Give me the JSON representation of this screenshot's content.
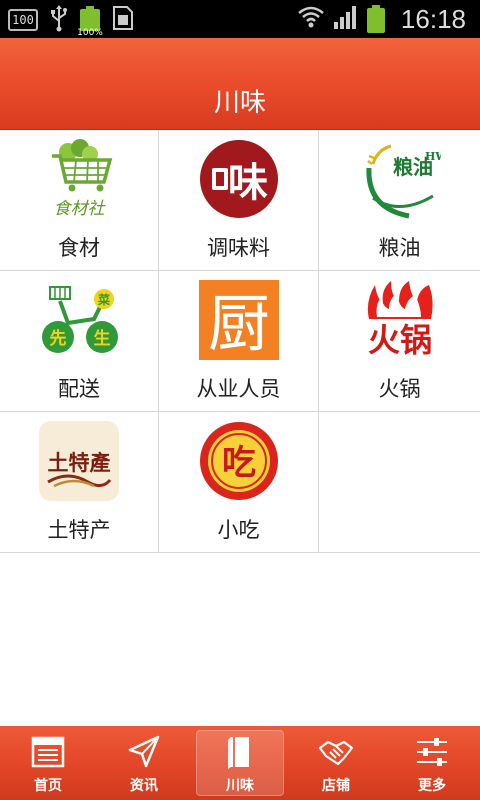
{
  "status_bar": {
    "box_label": "100",
    "battery_small_pct": "100%",
    "time": "16:18"
  },
  "header": {
    "title": "川味"
  },
  "grid": {
    "items": [
      {
        "label": "食材",
        "icon": "shopping-cart-vegetables-icon",
        "logo_text": "食材社"
      },
      {
        "label": "调味料",
        "icon": "spice-logo-icon",
        "logo_text": "味"
      },
      {
        "label": "粮油",
        "icon": "grain-oil-logo-icon",
        "logo_text": "粮油",
        "logo_sub": "HWP"
      },
      {
        "label": "配送",
        "icon": "delivery-bike-icon",
        "logo_text": "先生",
        "logo_badge": "菜"
      },
      {
        "label": "从业人员",
        "icon": "chef-logo-icon",
        "logo_text": "厨"
      },
      {
        "label": "火锅",
        "icon": "hotpot-flame-icon",
        "logo_text": "火锅"
      },
      {
        "label": "土特产",
        "icon": "local-specialty-icon",
        "logo_text": "土特產"
      },
      {
        "label": "小吃",
        "icon": "snack-logo-icon",
        "logo_text": "吃"
      }
    ]
  },
  "bottom_nav": {
    "items": [
      {
        "label": "首页",
        "icon": "newspaper-icon"
      },
      {
        "label": "资讯",
        "icon": "paper-plane-icon"
      },
      {
        "label": "川味",
        "icon": "book-icon",
        "active": true
      },
      {
        "label": "店铺",
        "icon": "handshake-icon"
      },
      {
        "label": "更多",
        "icon": "sliders-icon"
      }
    ]
  },
  "colors": {
    "accent": "#e84a2a",
    "header_text": "#ffffff",
    "grid_line": "#d6d6d6"
  }
}
